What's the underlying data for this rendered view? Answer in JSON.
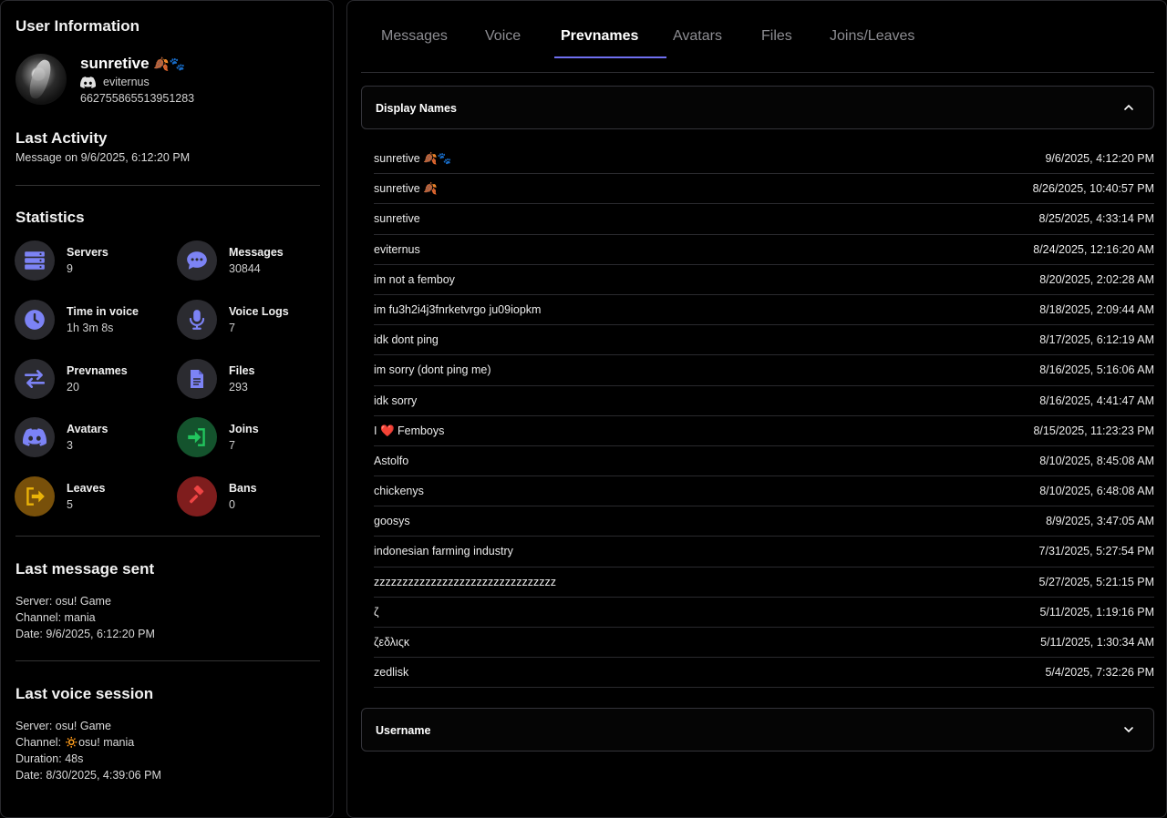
{
  "sidebar": {
    "title": "User Information",
    "user": {
      "display_name": "sunretive",
      "name_deco": "🍂🐾",
      "username": "eviternus",
      "id": "662755865513951283"
    },
    "last_activity": {
      "title": "Last Activity",
      "text": "Message on 9/6/2025, 6:12:20 PM"
    },
    "statistics": {
      "title": "Statistics",
      "items": [
        {
          "label": "Servers",
          "value": "9",
          "icon": "server-icon",
          "color": "#7c83f5"
        },
        {
          "label": "Messages",
          "value": "30844",
          "icon": "chat-icon",
          "color": "#7c83f5"
        },
        {
          "label": "Time in voice",
          "value": "1h 3m 8s",
          "icon": "clock-icon",
          "color": "#7c83f5"
        },
        {
          "label": "Voice Logs",
          "value": "7",
          "icon": "microphone-icon",
          "color": "#7c83f5"
        },
        {
          "label": "Prevnames",
          "value": "20",
          "icon": "swap-icon",
          "color": "#7c83f5"
        },
        {
          "label": "Files",
          "value": "293",
          "icon": "file-icon",
          "color": "#7c83f5"
        },
        {
          "label": "Avatars",
          "value": "3",
          "icon": "discord-icon",
          "color": "#7c83f5"
        },
        {
          "label": "Joins",
          "value": "7",
          "icon": "join-icon",
          "color": "#22c55e"
        },
        {
          "label": "Leaves",
          "value": "5",
          "icon": "leave-icon",
          "color": "#eab308"
        },
        {
          "label": "Bans",
          "value": "0",
          "icon": "gavel-icon",
          "color": "#ef4444"
        }
      ]
    },
    "last_message": {
      "title": "Last message sent",
      "server_label": "Server:",
      "server": "osu! Game",
      "channel_label": "Channel:",
      "channel": "mania",
      "date_label": "Date:",
      "date": "9/6/2025, 6:12:20 PM"
    },
    "last_voice": {
      "title": "Last voice session",
      "server_label": "Server:",
      "server": "osu! Game",
      "channel_label": "Channel:",
      "channel": "🔅osu! mania",
      "duration_label": "Duration:",
      "duration": "48s",
      "date_label": "Date:",
      "date": "8/30/2025, 4:39:06 PM"
    }
  },
  "tabs": [
    {
      "label": "Messages"
    },
    {
      "label": "Voice"
    },
    {
      "label": "Prevnames",
      "active": true
    },
    {
      "label": "Avatars"
    },
    {
      "label": "Files"
    },
    {
      "label": "Joins/Leaves"
    }
  ],
  "display_names": {
    "title": "Display Names",
    "rows": [
      {
        "name": "sunretive 🍂🐾",
        "date": "9/6/2025, 4:12:20 PM"
      },
      {
        "name": "sunretive 🍂",
        "date": "8/26/2025, 10:40:57 PM"
      },
      {
        "name": "sunretive",
        "date": "8/25/2025, 4:33:14 PM"
      },
      {
        "name": "eviternus",
        "date": "8/24/2025, 12:16:20 AM"
      },
      {
        "name": "im not a femboy",
        "date": "8/20/2025, 2:02:28 AM"
      },
      {
        "name": "im fu3h2i4j3fnrketvrgo ju09iopkm",
        "date": "8/18/2025, 2:09:44 AM"
      },
      {
        "name": "idk dont ping",
        "date": "8/17/2025, 6:12:19 AM"
      },
      {
        "name": "im sorry (dont ping me)",
        "date": "8/16/2025, 5:16:06 AM"
      },
      {
        "name": "idk sorry",
        "date": "8/16/2025, 4:41:47 AM"
      },
      {
        "name": "I ❤️ Femboys",
        "date": "8/15/2025, 11:23:23 PM"
      },
      {
        "name": "Astolfo",
        "date": "8/10/2025, 8:45:08 AM"
      },
      {
        "name": "chickenys",
        "date": "8/10/2025, 6:48:08 AM"
      },
      {
        "name": "goosys",
        "date": "8/9/2025, 3:47:05 AM"
      },
      {
        "name": "indonesian farming industry",
        "date": "7/31/2025, 5:27:54 PM"
      },
      {
        "name": "zzzzzzzzzzzzzzzzzzzzzzzzzzzzzzzz",
        "date": "5/27/2025, 5:21:15 PM"
      },
      {
        "name": "ζ",
        "date": "5/11/2025, 1:19:16 PM"
      },
      {
        "name": "ζεδλιςκ",
        "date": "5/11/2025, 1:30:34 AM"
      },
      {
        "name": "zedlisk",
        "date": "5/4/2025, 7:32:26 PM"
      }
    ]
  },
  "usernames": {
    "title": "Username"
  }
}
